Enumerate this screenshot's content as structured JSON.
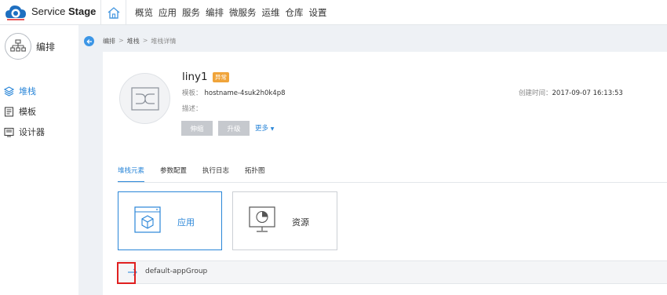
{
  "header": {
    "brand_regular": "Service ",
    "brand_bold": "Stage",
    "nav_items": [
      "概览",
      "应用",
      "服务",
      "编排",
      "微服务",
      "运维",
      "仓库",
      "设置"
    ]
  },
  "sidebar": {
    "title": "编排",
    "items": [
      {
        "label": "堆栈",
        "icon": "stack-icon",
        "active": true
      },
      {
        "label": "模板",
        "icon": "template-icon",
        "active": false
      },
      {
        "label": "设计器",
        "icon": "designer-icon",
        "active": false
      }
    ]
  },
  "breadcrumb": [
    "编排",
    "堆栈",
    "堆栈详情"
  ],
  "stack": {
    "name": "liny1",
    "status": "异常",
    "template_label": "模板：",
    "template_value": "hostname-4suk2h0k4p8",
    "desc_label": "描述：",
    "desc_value": "",
    "created_label": "创建时间：",
    "created_value": "2017-09-07 16:13:53"
  },
  "actions": {
    "scale": "伸缩",
    "upgrade": "升级",
    "more": "更多"
  },
  "tabs": [
    "堆栈元素",
    "参数配置",
    "执行日志",
    "拓扑图"
  ],
  "cards": [
    {
      "label": "应用",
      "icon": "app-box-icon",
      "selected": true
    },
    {
      "label": "资源",
      "icon": "resource-chart-icon",
      "selected": false
    }
  ],
  "group": {
    "label": "default-appGroup"
  },
  "colors": {
    "accent": "#2a86d8",
    "warning": "#f0a43a",
    "highlight": "#e02020"
  }
}
